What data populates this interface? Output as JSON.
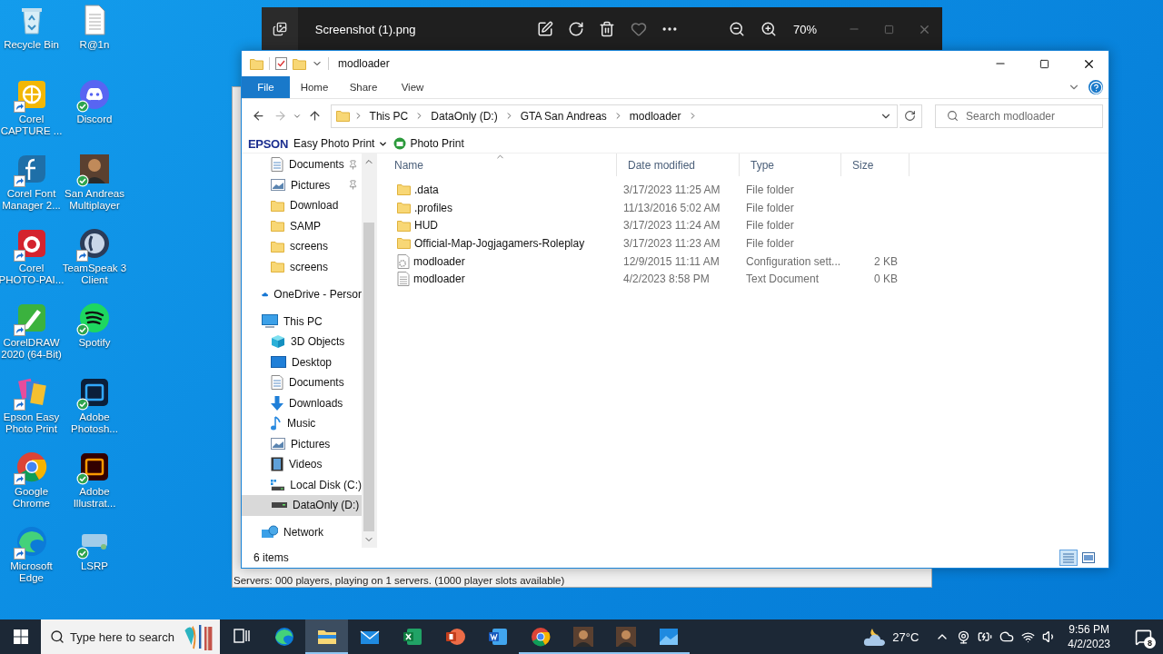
{
  "desktop_icons": [
    {
      "label": "Recycle Bin",
      "kind": "recycle",
      "shortcut": false,
      "synced": false
    },
    {
      "label": "R@1n",
      "kind": "textfile",
      "shortcut": false,
      "synced": false
    },
    {
      "label": "Corel CAPTURE ...",
      "kind": "capture",
      "shortcut": true,
      "synced": false
    },
    {
      "label": "Discord",
      "kind": "discord",
      "shortcut": false,
      "synced": true
    },
    {
      "label": "Corel Font Manager 2...",
      "kind": "fontmgr",
      "shortcut": true,
      "synced": false
    },
    {
      "label": "San Andreas Multiplayer",
      "kind": "avatar",
      "shortcut": false,
      "synced": true
    },
    {
      "label": "Corel PHOTO-PAI...",
      "kind": "photopaint",
      "shortcut": true,
      "synced": false
    },
    {
      "label": "TeamSpeak 3 Client",
      "kind": "teamspeak",
      "shortcut": true,
      "synced": false
    },
    {
      "label": "CorelDRAW 2020 (64-Bit)",
      "kind": "coreldraw",
      "shortcut": true,
      "synced": false
    },
    {
      "label": "Spotify",
      "kind": "spotify",
      "shortcut": false,
      "synced": true
    },
    {
      "label": "Epson Easy Photo Print",
      "kind": "epson",
      "shortcut": true,
      "synced": false
    },
    {
      "label": "Adobe Photosh...",
      "kind": "ps",
      "shortcut": false,
      "synced": true
    },
    {
      "label": "Google Chrome",
      "kind": "chrome",
      "shortcut": true,
      "synced": false
    },
    {
      "label": "Adobe Illustrat...",
      "kind": "ai",
      "shortcut": false,
      "synced": true
    },
    {
      "label": "Microsoft Edge",
      "kind": "edge",
      "shortcut": true,
      "synced": false
    },
    {
      "label": "LSRP",
      "kind": "lsrp",
      "shortcut": false,
      "synced": true
    }
  ],
  "background_window": {
    "status_text": "Servers: 000 players, playing on 1 servers. (1000 player slots available)"
  },
  "photo_viewer": {
    "title": "Screenshot (1).png",
    "zoom": "70%"
  },
  "explorer": {
    "title": "modloader",
    "ribbon_tabs": [
      {
        "label": "File",
        "kind": "backstage"
      },
      {
        "label": "Home",
        "kind": "tab"
      },
      {
        "label": "Share",
        "kind": "tab"
      },
      {
        "label": "View",
        "kind": "tab"
      }
    ],
    "breadcrumb": [
      "This PC",
      "DataOnly (D:)",
      "GTA San Andreas",
      "modloader"
    ],
    "search": {
      "placeholder": "Search modloader"
    },
    "epson_toolbar": {
      "brand": "EPSON",
      "menu": "Easy Photo Print",
      "action": "Photo Print"
    },
    "quick_access": [
      {
        "label": "Documents",
        "kind": "documents",
        "pinned": true,
        "selected": false
      },
      {
        "label": "Pictures",
        "kind": "pictures",
        "pinned": true,
        "selected": false
      },
      {
        "label": "Download",
        "kind": "folder",
        "pinned": false,
        "selected": false
      },
      {
        "label": "SAMP",
        "kind": "folder",
        "pinned": false,
        "selected": false
      },
      {
        "label": "screens",
        "kind": "folder",
        "pinned": false,
        "selected": false
      },
      {
        "label": "screens",
        "kind": "folder",
        "pinned": false,
        "selected": false
      }
    ],
    "nav": [
      {
        "label": "OneDrive - Persor",
        "kind": "cloud",
        "selected": false
      },
      {
        "label": "This PC",
        "kind": "pc",
        "selected": false,
        "children": [
          {
            "label": "3D Objects",
            "kind": "cube",
            "selected": false
          },
          {
            "label": "Desktop",
            "kind": "desktop",
            "selected": false
          },
          {
            "label": "Documents",
            "kind": "documents",
            "selected": false
          },
          {
            "label": "Downloads",
            "kind": "download",
            "selected": false
          },
          {
            "label": "Music",
            "kind": "music",
            "selected": false
          },
          {
            "label": "Pictures",
            "kind": "pictures",
            "selected": false
          },
          {
            "label": "Videos",
            "kind": "video",
            "selected": false
          },
          {
            "label": "Local Disk (C:)",
            "kind": "disk",
            "selected": false
          },
          {
            "label": "DataOnly (D:)",
            "kind": "drive",
            "selected": true
          }
        ]
      },
      {
        "label": "Network",
        "kind": "network",
        "selected": false
      }
    ],
    "columns": [
      {
        "label": "Name",
        "sorted": true
      },
      {
        "label": "Date modified",
        "sorted": false
      },
      {
        "label": "Type",
        "sorted": false
      },
      {
        "label": "Size",
        "sorted": false
      }
    ],
    "files": [
      {
        "name": ".data",
        "kind": "folder",
        "date": "3/17/2023 11:25 AM",
        "type": "File folder"
      },
      {
        "name": ".profiles",
        "kind": "folder",
        "date": "11/13/2016 5:02 AM",
        "type": "File folder"
      },
      {
        "name": "HUD",
        "kind": "folder",
        "date": "3/17/2023 11:24 AM",
        "type": "File folder"
      },
      {
        "name": "Official-Map-Jogjagamers-Roleplay",
        "kind": "folder",
        "date": "3/17/2023 11:23 AM",
        "type": "File folder"
      },
      {
        "name": "modloader",
        "kind": "config",
        "date": "12/9/2015 11:11 AM",
        "type": "Configuration sett...",
        "size": "2 KB"
      },
      {
        "name": "modloader",
        "kind": "text",
        "date": "4/2/2023 8:58 PM",
        "type": "Text Document",
        "size": "0 KB"
      }
    ],
    "status": "6 items",
    "view_buttons": [
      {
        "kind": "details",
        "selected": true
      },
      {
        "kind": "tiles",
        "selected": false
      }
    ]
  },
  "taskbar": {
    "search_placeholder": "Type here to search",
    "apps": [
      {
        "kind": "taskview",
        "open": false,
        "active": false
      },
      {
        "kind": "edge",
        "open": false,
        "active": false
      },
      {
        "kind": "explorer",
        "open": true,
        "active": true
      },
      {
        "kind": "mail",
        "open": false,
        "active": false
      },
      {
        "kind": "excel",
        "open": false,
        "active": false
      },
      {
        "kind": "powerpoint",
        "open": false,
        "active": false
      },
      {
        "kind": "word",
        "open": false,
        "active": false
      },
      {
        "kind": "chrome",
        "open": true,
        "active": false
      },
      {
        "kind": "avatar",
        "open": true,
        "active": false
      },
      {
        "kind": "avatar",
        "open": true,
        "active": false
      },
      {
        "kind": "photos",
        "open": true,
        "active": false
      }
    ],
    "weather": "27°C",
    "time": "9:56 PM",
    "date": "4/2/2023",
    "notification_count": "8"
  }
}
